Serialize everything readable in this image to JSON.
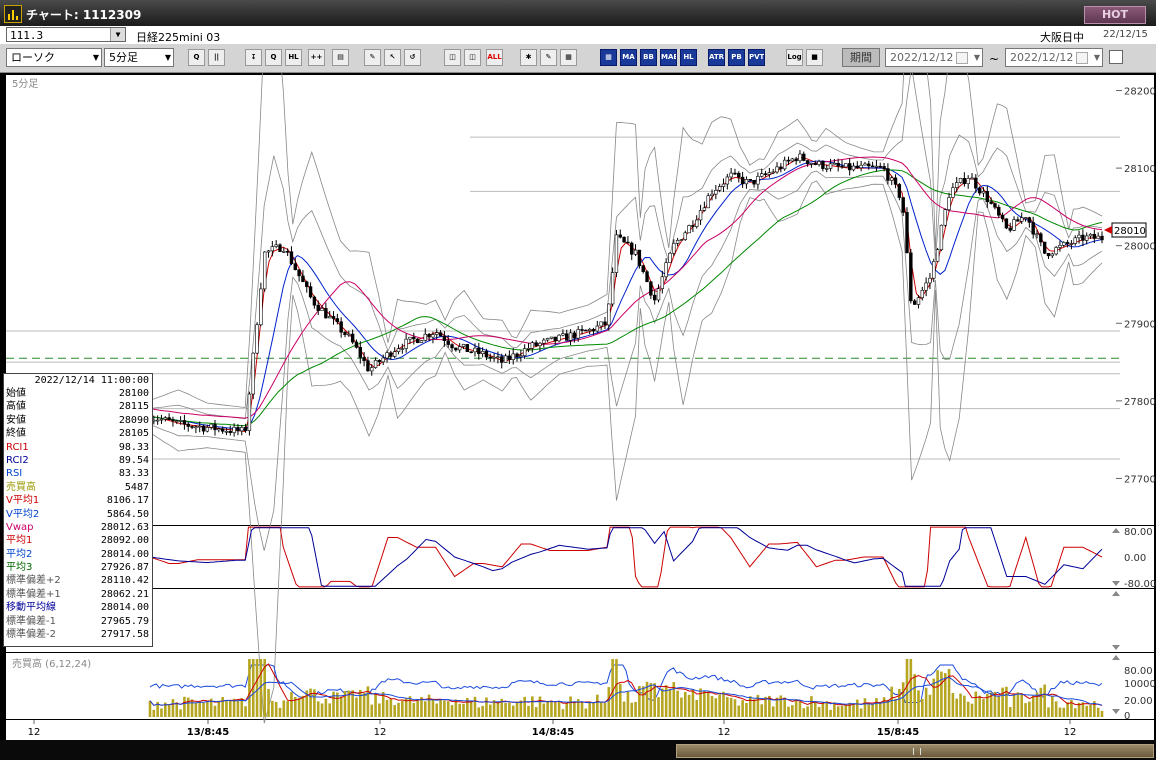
{
  "window": {
    "title": "チャート: 1112309",
    "hot_label": "HOT"
  },
  "header": {
    "code": "111.3",
    "instrument": "日経225mini 03",
    "market": "大阪日中",
    "date": "22/12/15"
  },
  "toolbar": {
    "chart_type": "ローソク",
    "interval": "5分足",
    "period_label": "期間",
    "date_from": "2022/12/12",
    "date_to": "2022/12/12",
    "tilde": "~",
    "buttons": [
      "Q",
      "||",
      "↧",
      "Q",
      "HL",
      "++",
      "▤",
      "✎",
      "↖",
      "↺",
      "◫",
      "◫",
      "ALL",
      "✱",
      "✎",
      "▦",
      "▦",
      "MA",
      "BB",
      "MAE",
      "HL",
      "ATR",
      "PB",
      "PVT",
      "Log",
      "■"
    ]
  },
  "chart": {
    "period_label": "5分足",
    "volume_label": "売買高 (6,12,24)",
    "current_price_label": "28010",
    "price_ticks": [
      "28200",
      "28100",
      "28000",
      "27900",
      "27800",
      "27700"
    ],
    "osc1_ticks": [
      "80.00",
      "0.00",
      "-80.00"
    ],
    "osc2_ticks": [
      "80.00",
      "20.00"
    ],
    "volume_ticks": [
      "10000",
      "0"
    ],
    "time_labels": [
      "12",
      "13/8:45",
      "12",
      "14/8:45",
      "12",
      "15/8:45",
      "12"
    ]
  },
  "info_panel": {
    "datetime": "2022/12/14 11:00:00",
    "rows": [
      {
        "label": "始値",
        "value": "28100",
        "color": "#000000"
      },
      {
        "label": "高値",
        "value": "28115",
        "color": "#000000"
      },
      {
        "label": "安値",
        "value": "28090",
        "color": "#000000"
      },
      {
        "label": "終値",
        "value": "28105",
        "color": "#000000"
      },
      {
        "label": "RCI1",
        "value": "98.33",
        "color": "#cc0000"
      },
      {
        "label": "RCI2",
        "value": "89.54",
        "color": "#000099"
      },
      {
        "label": "RSI",
        "value": "83.33",
        "color": "#0044cc"
      },
      {
        "label": "売買高",
        "value": "5487",
        "color": "#999900"
      },
      {
        "label": "V平均1",
        "value": "8106.17",
        "color": "#cc0000"
      },
      {
        "label": "V平均2",
        "value": "5864.50",
        "color": "#0044cc"
      },
      {
        "label": "Vwap",
        "value": "28012.63",
        "color": "#cc0066"
      },
      {
        "label": "平均1",
        "value": "28092.00",
        "color": "#cc0000"
      },
      {
        "label": "平均2",
        "value": "28014.00",
        "color": "#0044cc"
      },
      {
        "label": "平均3",
        "value": "27926.87",
        "color": "#006600"
      },
      {
        "label": "標準偏差+2",
        "value": "28110.42",
        "color": "#555555"
      },
      {
        "label": "標準偏差+1",
        "value": "28062.21",
        "color": "#555555"
      },
      {
        "label": "移動平均線",
        "value": "28014.00",
        "color": "#000099"
      },
      {
        "label": "標準偏差-1",
        "value": "27965.79",
        "color": "#555555"
      },
      {
        "label": "標準偏差-2",
        "value": "27917.58",
        "color": "#555555"
      }
    ]
  },
  "chart_data": {
    "type": "candlestick",
    "price_range": [
      27640,
      28220
    ],
    "close_trace": [
      [
        0,
        27780
      ],
      [
        0.03,
        27770
      ],
      [
        0.1,
        27760
      ],
      [
        0.12,
        27990
      ],
      [
        0.14,
        28000
      ],
      [
        0.17,
        27930
      ],
      [
        0.21,
        27880
      ],
      [
        0.23,
        27840
      ],
      [
        0.26,
        27870
      ],
      [
        0.3,
        27890
      ],
      [
        0.32,
        27870
      ],
      [
        0.35,
        27860
      ],
      [
        0.37,
        27850
      ],
      [
        0.4,
        27870
      ],
      [
        0.43,
        27880
      ],
      [
        0.46,
        27890
      ],
      [
        0.48,
        27900
      ],
      [
        0.49,
        28010
      ],
      [
        0.51,
        27990
      ],
      [
        0.53,
        27930
      ],
      [
        0.55,
        28000
      ],
      [
        0.57,
        28030
      ],
      [
        0.59,
        28070
      ],
      [
        0.61,
        28090
      ],
      [
        0.63,
        28080
      ],
      [
        0.66,
        28100
      ],
      [
        0.68,
        28115
      ],
      [
        0.7,
        28105
      ],
      [
        0.73,
        28100
      ],
      [
        0.77,
        28100
      ],
      [
        0.79,
        28060
      ],
      [
        0.8,
        27920
      ],
      [
        0.82,
        27960
      ],
      [
        0.84,
        28070
      ],
      [
        0.86,
        28090
      ],
      [
        0.88,
        28060
      ],
      [
        0.9,
        28020
      ],
      [
        0.92,
        28040
      ],
      [
        0.94,
        27990
      ],
      [
        0.96,
        28000
      ],
      [
        0.98,
        28010
      ],
      [
        1,
        28010
      ]
    ],
    "levels": [
      28140,
      28070,
      27890,
      27850,
      27835,
      27790,
      27725
    ],
    "dashed_level": 27855
  }
}
